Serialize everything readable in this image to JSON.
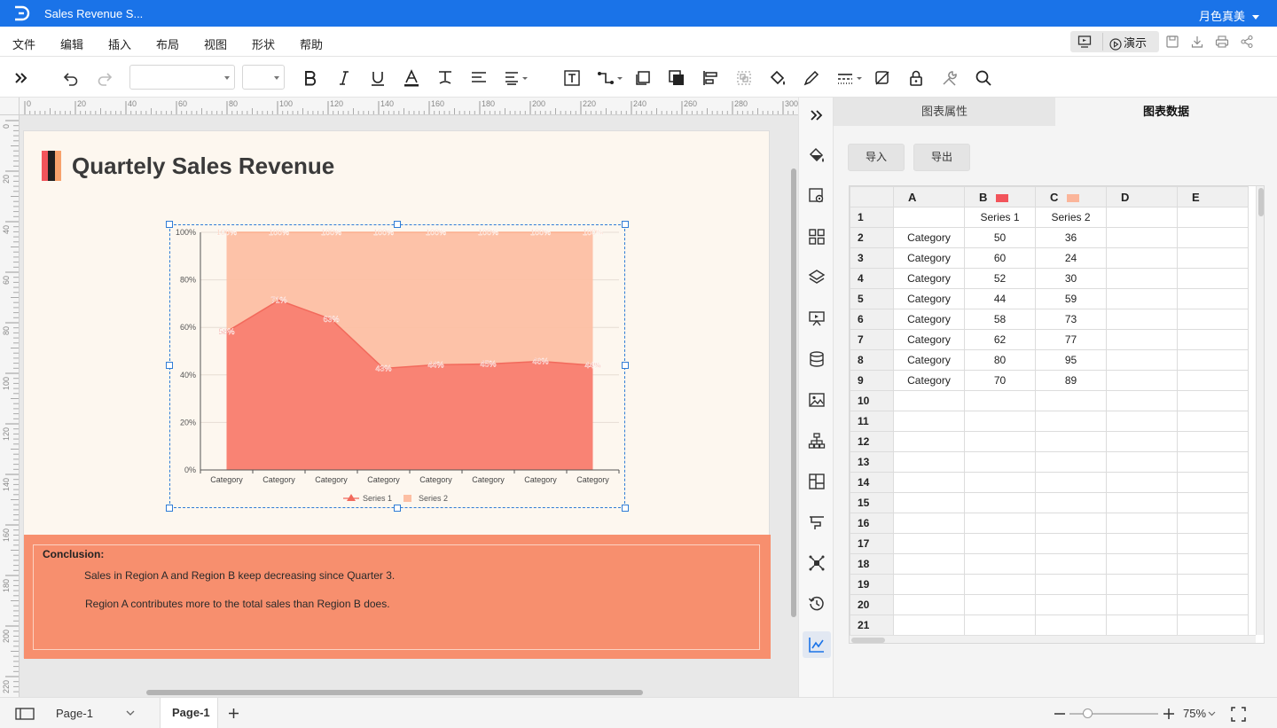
{
  "app": {
    "doc_title": "Sales Revenue S...",
    "user_name": "月色真美"
  },
  "menu": {
    "items": [
      "文件",
      "编辑",
      "插入",
      "布局",
      "视图",
      "形状",
      "帮助"
    ],
    "present_label": "演示"
  },
  "ruler": {
    "h_ticks": [
      "0",
      "20",
      "40",
      "60",
      "80",
      "100",
      "120",
      "140",
      "160",
      "180",
      "200",
      "220",
      "240",
      "260",
      "280",
      "300"
    ],
    "v_ticks": [
      "0",
      "20",
      "40",
      "60",
      "80",
      "100",
      "120",
      "140",
      "160",
      "180",
      "200",
      "220"
    ]
  },
  "page": {
    "title": "Quartely Sales Revenue",
    "title_icon_colors": [
      "#f2545b",
      "#1f1f1f",
      "#f7a26c"
    ]
  },
  "conclusion": {
    "heading": "Conclusion:",
    "lines": [
      "Sales in Region A and Region B keep decreasing since Quarter 3.",
      "Region A contributes more to the total sales than Region B does."
    ]
  },
  "chart_data": {
    "type": "area",
    "stacked_percent": true,
    "categories": [
      "Category",
      "Category",
      "Category",
      "Category",
      "Category",
      "Category",
      "Category",
      "Category"
    ],
    "series": [
      {
        "name": "Series 1",
        "values": [
          50,
          60,
          52,
          44,
          58,
          62,
          80,
          70
        ],
        "color": "#f98374",
        "marker": "triangle"
      },
      {
        "name": "Series 2",
        "values": [
          36,
          24,
          30,
          59,
          73,
          77,
          95,
          89
        ],
        "color": "#fdbfa3",
        "marker": "square"
      }
    ],
    "s1_labels": [
      "58%",
      "71%",
      "63%",
      "43%",
      "44%",
      "45%",
      "46%",
      "44%"
    ],
    "top_labels": [
      "100%",
      "100%",
      "100%",
      "100%",
      "100%",
      "100%",
      "100%",
      "100%"
    ],
    "y_ticks": [
      "0%",
      "20%",
      "40%",
      "60%",
      "80%",
      "100%"
    ],
    "ylim": [
      0,
      100
    ],
    "legend": "bottom",
    "grid": true
  },
  "panel": {
    "tabs": [
      "图表属性",
      "图表数据"
    ],
    "import_label": "导入",
    "export_label": "导出",
    "columns": [
      "A",
      "B",
      "C",
      "D",
      "E"
    ],
    "series_colors": [
      "#f2545b",
      "#fbb59a"
    ],
    "header_row": [
      "",
      "Series 1",
      "Series 2",
      "",
      ""
    ],
    "rows": [
      [
        "Category",
        "50",
        "36"
      ],
      [
        "Category",
        "60",
        "24"
      ],
      [
        "Category",
        "52",
        "30"
      ],
      [
        "Category",
        "44",
        "59"
      ],
      [
        "Category",
        "58",
        "73"
      ],
      [
        "Category",
        "62",
        "77"
      ],
      [
        "Category",
        "80",
        "95"
      ],
      [
        "Category",
        "70",
        "89"
      ]
    ],
    "row_numbers": [
      "1",
      "2",
      "3",
      "4",
      "5",
      "6",
      "7",
      "8",
      "9",
      "10",
      "11",
      "12",
      "13",
      "14",
      "15",
      "16",
      "17",
      "18",
      "19",
      "20",
      "21"
    ]
  },
  "status": {
    "page_selector": "Page-1",
    "page_tab": "Page-1",
    "zoom": "75%"
  },
  "icons": {
    "toolbar": [
      "expand-icon",
      "undo-icon",
      "redo-icon",
      "bold-icon",
      "italic-icon",
      "underline-icon",
      "font-color-icon",
      "text-style-icon",
      "align-icon",
      "line-spacing-icon",
      "textbox-icon",
      "connector-icon",
      "bring-front-icon",
      "send-back-icon",
      "align-objects-icon",
      "group-icon",
      "fill-icon",
      "pen-icon",
      "line-style-icon",
      "shadow-icon",
      "lock-icon",
      "tools-icon",
      "search-icon"
    ],
    "sidebar": [
      "fill-icon",
      "settings-icon",
      "grid-icon",
      "layers-icon",
      "presentation-icon",
      "database-icon",
      "image-icon",
      "orgchart-icon",
      "layout-icon",
      "gantt-icon",
      "mindmap-icon",
      "history-icon",
      "chart-icon"
    ]
  },
  "colors": {
    "brand": "#1a73e8",
    "conclusion_bg": "#f78f6e",
    "page_bg": "#fdf7ef"
  }
}
